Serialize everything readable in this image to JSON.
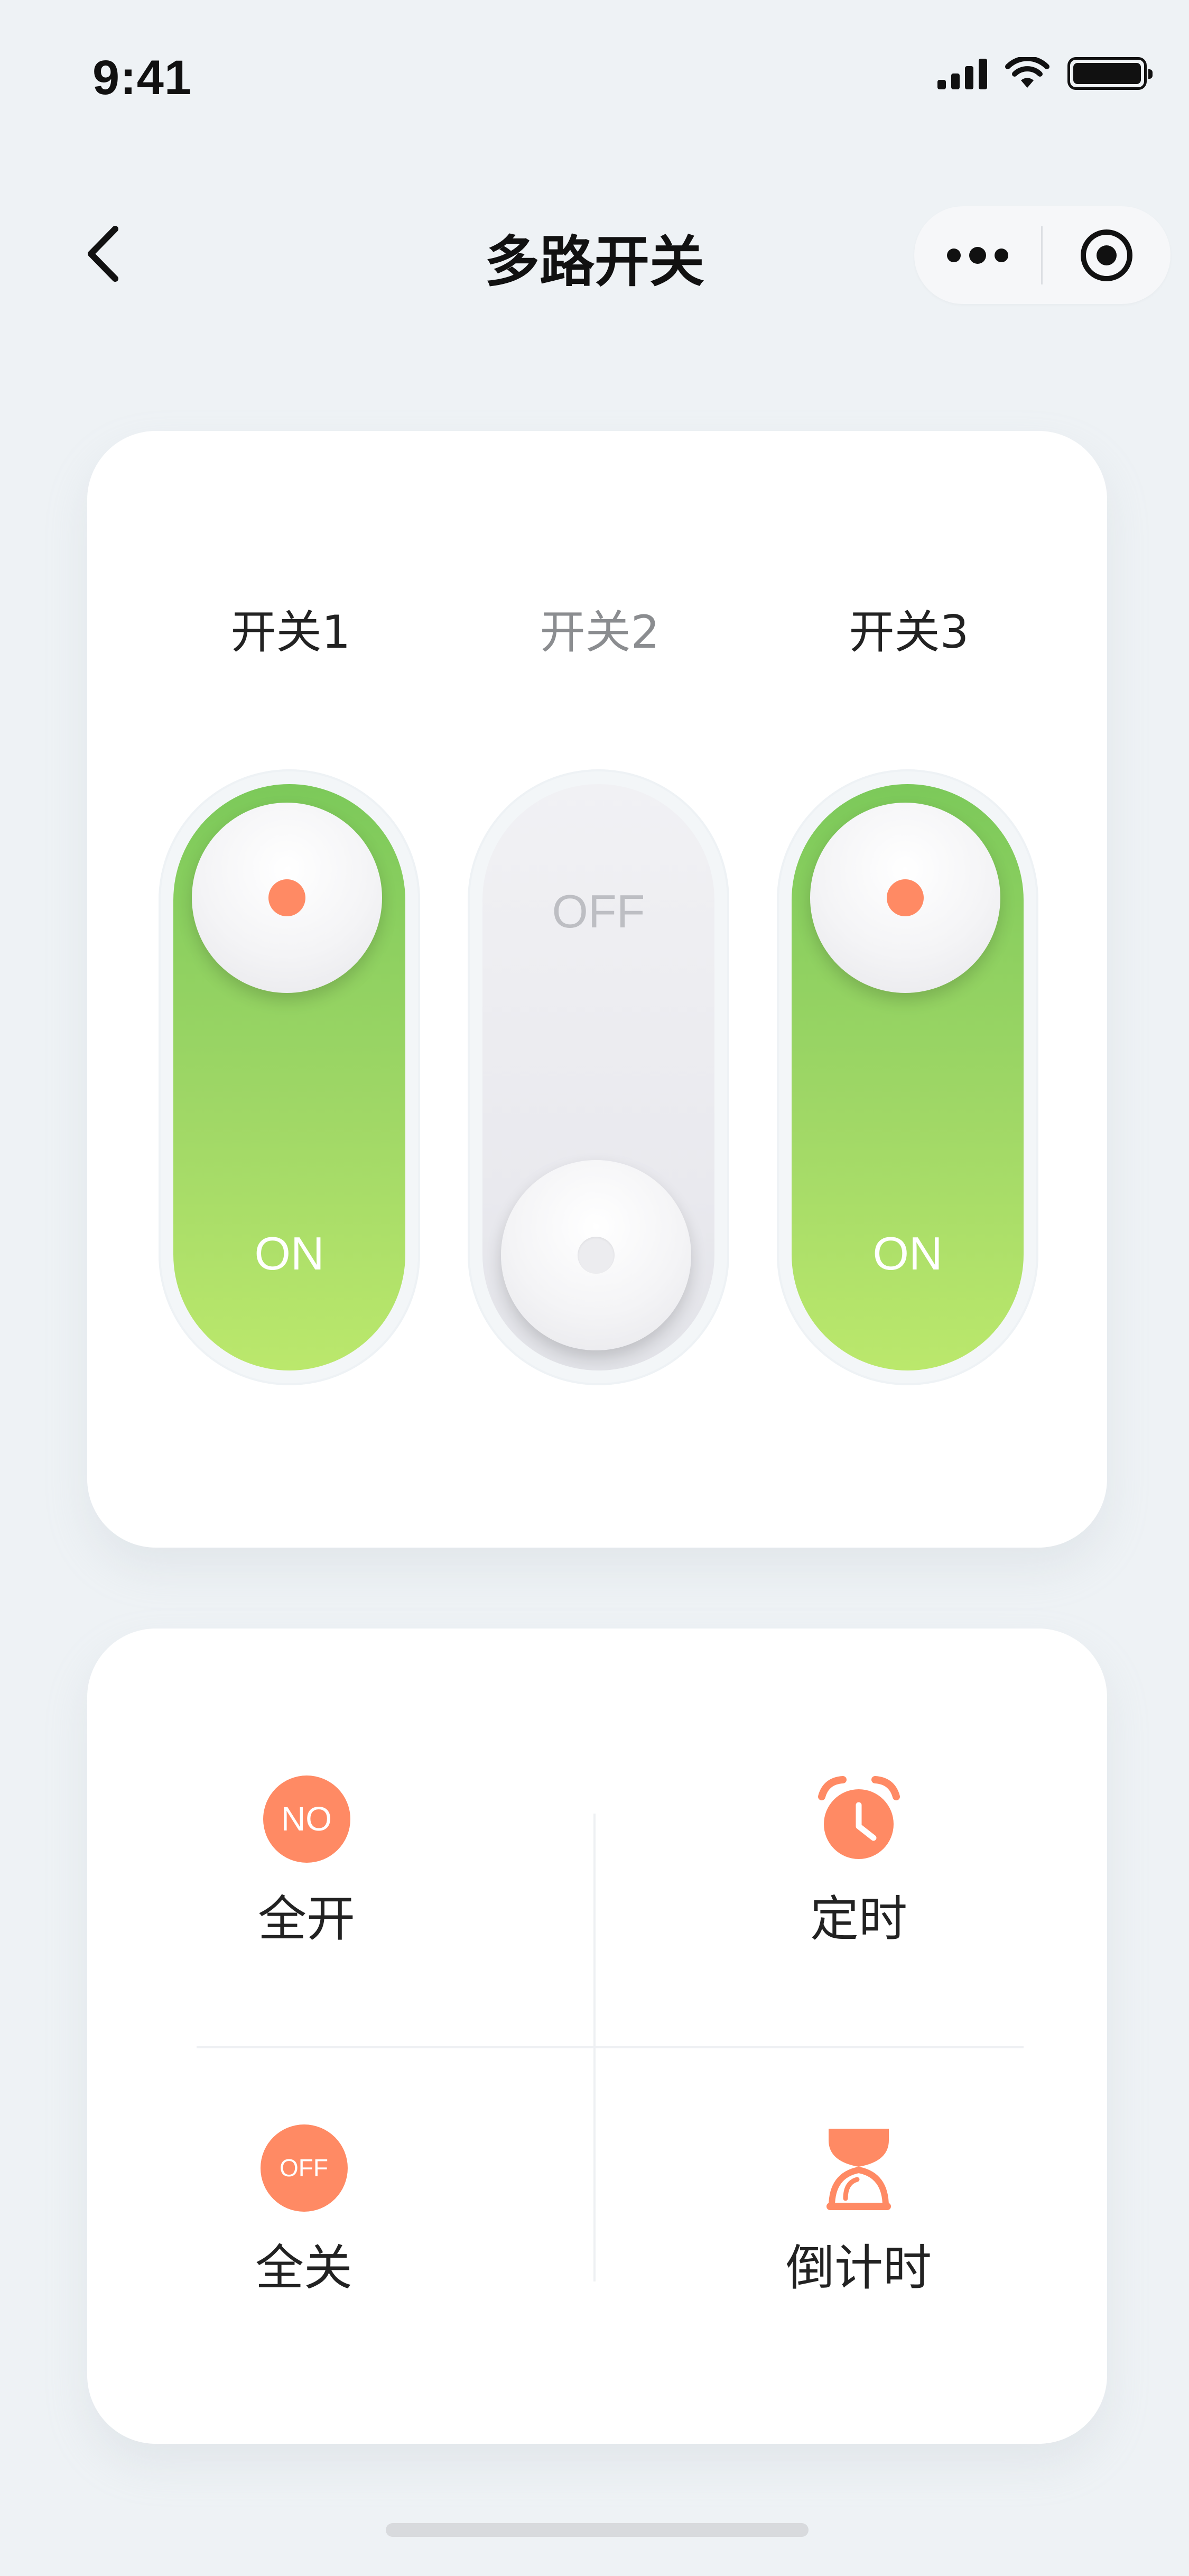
{
  "status_bar": {
    "time": "9:41"
  },
  "nav": {
    "title": "多路开关"
  },
  "switches": [
    {
      "label": "开关1",
      "state": "ON",
      "on": true
    },
    {
      "label": "开关2",
      "state": "OFF",
      "on": false
    },
    {
      "label": "开关3",
      "state": "ON",
      "on": true
    }
  ],
  "actions": {
    "all_on": {
      "label": "全开",
      "badge": "NO"
    },
    "timer": {
      "label": "定时"
    },
    "all_off": {
      "label": "全关",
      "badge": "OFF"
    },
    "countdown": {
      "label": "倒计时"
    }
  },
  "colors": {
    "accent": "#ff8a64",
    "on_green_top": "#7cc95a",
    "on_green_bottom": "#bbe86c",
    "background": "#eef2f5"
  },
  "icons": [
    "signal-icon",
    "wifi-icon",
    "battery-icon",
    "back-chevron-icon",
    "more-dots-icon",
    "target-icon",
    "alarm-clock-icon",
    "hourglass-icon"
  ]
}
